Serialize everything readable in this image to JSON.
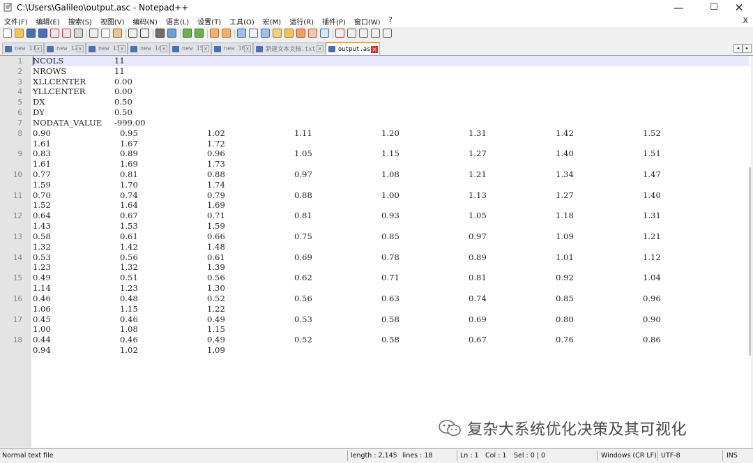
{
  "window": {
    "title": "C:\\Users\\Galileo\\output.asc - Notepad++",
    "minimize": "—",
    "maximize": "☐",
    "close": "✕"
  },
  "menu": {
    "items": [
      "文件(F)",
      "编辑(E)",
      "搜索(S)",
      "视图(V)",
      "编码(N)",
      "语言(L)",
      "设置(T)",
      "工具(O)",
      "宏(M)",
      "运行(R)",
      "插件(P)",
      "窗口(W)",
      "?"
    ],
    "close": "X"
  },
  "tabs": [
    {
      "label": "new 11",
      "active": false
    },
    {
      "label": "new 12",
      "active": false
    },
    {
      "label": "new 13",
      "active": false
    },
    {
      "label": "new 14",
      "active": false
    },
    {
      "label": "new 15",
      "active": false
    },
    {
      "label": "new 16",
      "active": false
    },
    {
      "label": "新建文本文档.txt",
      "active": false
    },
    {
      "label": "output.asc",
      "active": true
    }
  ],
  "tab_close_glyph": "x",
  "tab_scroll": {
    "left": "◂",
    "right": "▸"
  },
  "editor": {
    "header_lines": [
      {
        "n": "1",
        "key": "NCOLS",
        "val": "11"
      },
      {
        "n": "2",
        "key": "NROWS",
        "val": "11"
      },
      {
        "n": "3",
        "key": "XLLCENTER",
        "val": "0.00"
      },
      {
        "n": "4",
        "key": "YLLCENTER",
        "val": "0.00"
      },
      {
        "n": "5",
        "key": "DX",
        "val": "0.50"
      },
      {
        "n": "6",
        "key": "DY",
        "val": "0.50"
      },
      {
        "n": "7",
        "key": "NODATA_VALUE",
        "val": "-999.00"
      }
    ],
    "data_lines": [
      {
        "n": "8",
        "row1": [
          "0.90",
          "0.95",
          "1.02",
          "1.11",
          "1.20",
          "1.31",
          "1.42",
          "1.52"
        ],
        "row2": [
          "1.61",
          "1.67",
          "1.72"
        ]
      },
      {
        "n": "9",
        "row1": [
          "0.83",
          "0.89",
          "0.96",
          "1.05",
          "1.15",
          "1.27",
          "1.40",
          "1.51"
        ],
        "row2": [
          "1.61",
          "1.69",
          "1.73"
        ]
      },
      {
        "n": "10",
        "row1": [
          "0.77",
          "0.81",
          "0.88",
          "0.97",
          "1.08",
          "1.21",
          "1.34",
          "1.47"
        ],
        "row2": [
          "1.59",
          "1.70",
          "1.74"
        ]
      },
      {
        "n": "11",
        "row1": [
          "0.70",
          "0.74",
          "0.79",
          "0.88",
          "1.00",
          "1.13",
          "1.27",
          "1.40"
        ],
        "row2": [
          "1.52",
          "1.64",
          "1.69"
        ]
      },
      {
        "n": "12",
        "row1": [
          "0.64",
          "0.67",
          "0.71",
          "0.81",
          "0.93",
          "1.05",
          "1.18",
          "1.31"
        ],
        "row2": [
          "1.43",
          "1.53",
          "1.59"
        ]
      },
      {
        "n": "13",
        "row1": [
          "0.58",
          "0.61",
          "0.66",
          "0.75",
          "0.85",
          "0.97",
          "1.09",
          "1.21"
        ],
        "row2": [
          "1.32",
          "1.42",
          "1.48"
        ]
      },
      {
        "n": "14",
        "row1": [
          "0.53",
          "0.56",
          "0.61",
          "0.69",
          "0.78",
          "0.89",
          "1.01",
          "1.12"
        ],
        "row2": [
          "1.23",
          "1.32",
          "1.39"
        ]
      },
      {
        "n": "15",
        "row1": [
          "0.49",
          "0.51",
          "0.56",
          "0.62",
          "0.71",
          "0.81",
          "0.92",
          "1.04"
        ],
        "row2": [
          "1.14",
          "1.23",
          "1.30"
        ]
      },
      {
        "n": "16",
        "row1": [
          "0.46",
          "0.48",
          "0.52",
          "0.56",
          "0.63",
          "0.74",
          "0.85",
          "0.96"
        ],
        "row2": [
          "1.06",
          "1.15",
          "1.22"
        ]
      },
      {
        "n": "17",
        "row1": [
          "0.45",
          "0.46",
          "0.49",
          "0.53",
          "0.58",
          "0.69",
          "0.80",
          "0.90"
        ],
        "row2": [
          "1.00",
          "1.08",
          "1.15"
        ]
      },
      {
        "n": "18",
        "row1": [
          "0.44",
          "0.46",
          "0.49",
          "0.52",
          "0.58",
          "0.67",
          "0.76",
          "0.86"
        ],
        "row2": [
          "0.94",
          "1.02",
          "1.09"
        ]
      }
    ]
  },
  "watermark": {
    "text": "复杂大系统优化决策及其可视化"
  },
  "status": {
    "file_type": "Normal text file",
    "length": "length : 2,145",
    "lines": "lines : 18",
    "ln": "Ln : 1",
    "col": "Col : 1",
    "sel": "Sel : 0 | 0",
    "eol": "Windows (CR LF)",
    "encoding": "UTF-8",
    "mode": "INS"
  },
  "colors": {
    "accent_tab": "#f0a030",
    "current_line": "#e8e8ff",
    "gutter": "#e4e4e4"
  }
}
